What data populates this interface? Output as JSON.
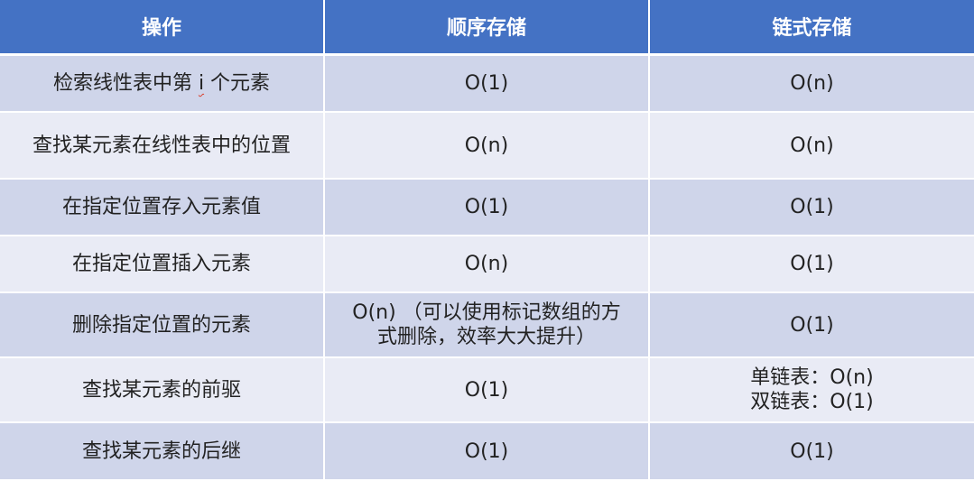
{
  "table": {
    "headers": [
      "操作",
      "顺序存储",
      "链式存储"
    ],
    "rows": [
      {
        "op_pre": "检索线性表中第 ",
        "op_var": "i",
        "op_post": " 个元素",
        "seq": "O(1)",
        "link": "O(n)"
      },
      {
        "op": "查找某元素在线性表中的位置",
        "seq": "O(n)",
        "link": "O(n)"
      },
      {
        "op": "在指定位置存入元素值",
        "seq": "O(1)",
        "link": "O(1)"
      },
      {
        "op": "在指定位置插入元素",
        "seq": "O(n)",
        "link": "O(1)"
      },
      {
        "op": "删除指定位置的元素",
        "seq_line1": "O(n) （可以使用标记数组的方",
        "seq_line2": "式删除，效率大大提升）",
        "link": "O(1)"
      },
      {
        "op": "查找某元素的前驱",
        "seq": "O(1)",
        "link_line1": "单链表：O(n)",
        "link_line2": "双链表：O(1)"
      },
      {
        "op": "查找某元素的后继",
        "seq": "O(1)",
        "link": "O(1)"
      }
    ]
  }
}
